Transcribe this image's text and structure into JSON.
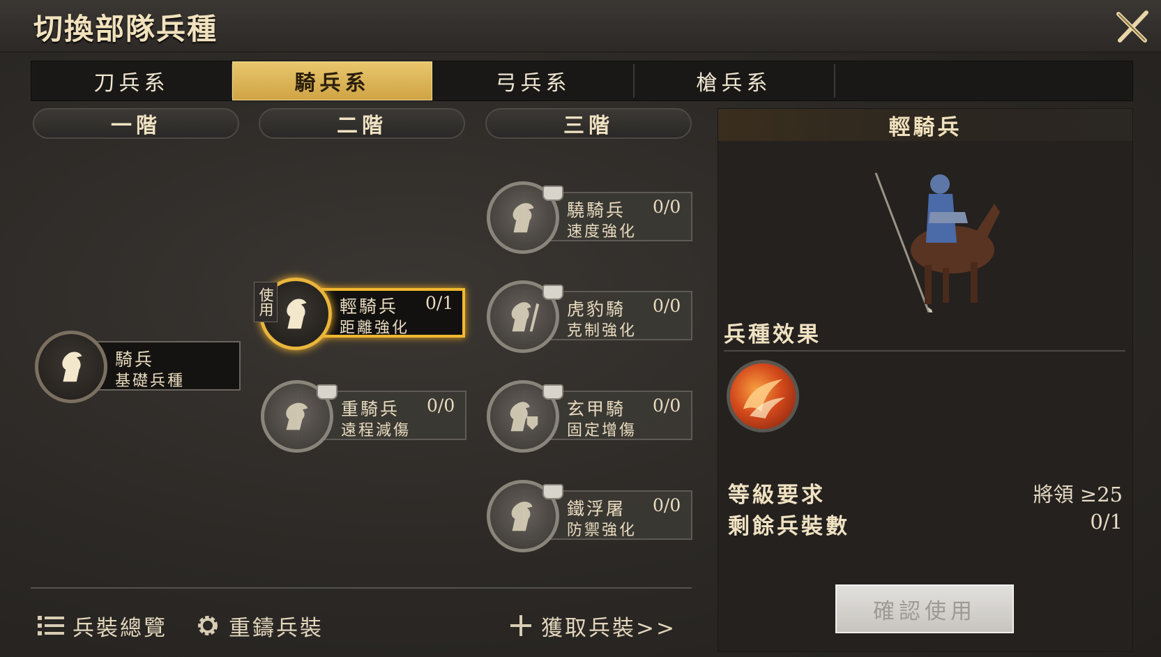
{
  "title": "切換部隊兵種",
  "tabs": [
    "刀兵系",
    "騎兵系",
    "弓兵系",
    "槍兵系"
  ],
  "active_tab": "騎兵系",
  "tiers": [
    "一階",
    "二階",
    "三階"
  ],
  "nodes": {
    "base": {
      "name": "騎兵",
      "desc": "基礎兵種"
    },
    "light": {
      "name": "輕騎兵",
      "desc": "距離強化",
      "count": "0/1",
      "badge": "使用"
    },
    "heavy": {
      "name": "重騎兵",
      "desc": "遠程減傷",
      "count": "0/0"
    },
    "swift": {
      "name": "驍騎兵",
      "desc": "速度強化",
      "count": "0/0"
    },
    "tiger": {
      "name": "虎豹騎",
      "desc": "克制強化",
      "count": "0/0"
    },
    "black": {
      "name": "玄甲騎",
      "desc": "固定增傷",
      "count": "0/0"
    },
    "iron": {
      "name": "鐵浮屠",
      "desc": "防禦強化",
      "count": "0/0"
    }
  },
  "bottom": {
    "overview": "兵裝總覽",
    "reforge": "重鑄兵裝",
    "obtain": "獲取兵裝>>"
  },
  "panel": {
    "title": "輕騎兵",
    "effects_title": "兵種效果",
    "req_label": "等級要求",
    "req_value": "將領 ≥25",
    "remain_label": "剩餘兵裝數",
    "remain_value": "0/1",
    "confirm": "確認使用"
  },
  "colors": {
    "gold": "#e9c66c",
    "select": "#f0b830"
  }
}
